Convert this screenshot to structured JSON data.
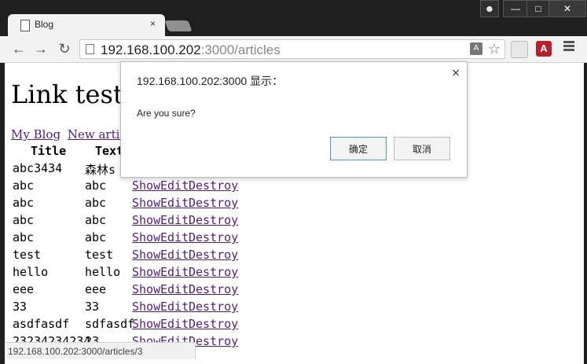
{
  "browser": {
    "tab_title": "Blog",
    "tab_close": "×",
    "window_buttons": [
      "—",
      "□",
      "✕"
    ],
    "url_host": "192.168.100.202",
    "url_path": ":3000/articles",
    "translate_icon": "A"
  },
  "page": {
    "title": "Link test",
    "links": [
      {
        "label": "My Blog"
      },
      {
        "label": "New article"
      }
    ],
    "table": {
      "headers": [
        "Title",
        "Text"
      ],
      "rows": [
        {
          "title": "abc3434",
          "text": "森林s",
          "show": "",
          "edit": "",
          "destroy": ""
        },
        {
          "title": "abc",
          "text": "abc",
          "show": "Show",
          "edit": "Edit",
          "destroy": "Destroy"
        },
        {
          "title": "abc",
          "text": "abc",
          "show": "Show",
          "edit": "Edit",
          "destroy": "Destroy"
        },
        {
          "title": "abc",
          "text": "abc",
          "show": "Show",
          "edit": "Edit",
          "destroy": "Destroy"
        },
        {
          "title": "abc",
          "text": "abc",
          "show": "Show",
          "edit": "Edit",
          "destroy": "Destroy"
        },
        {
          "title": "test",
          "text": "test",
          "show": "Show",
          "edit": "Edit",
          "destroy": "Destroy"
        },
        {
          "title": "hello",
          "text": "hello",
          "show": "Show",
          "edit": "Edit",
          "destroy": "Destroy"
        },
        {
          "title": "eee",
          "text": "eee",
          "show": "Show",
          "edit": "Edit",
          "destroy": "Destroy"
        },
        {
          "title": "33",
          "text": "33",
          "show": "Show",
          "edit": "Edit",
          "destroy": "Destroy"
        },
        {
          "title": "asdfasdf",
          "text": "sdfasdf",
          "show": "Show",
          "edit": "Edit",
          "destroy": "Destroy"
        },
        {
          "title": "23234234234",
          "text": "23",
          "show": "Show",
          "edit": "Edit",
          "destroy": "Destroy"
        }
      ]
    }
  },
  "dialog": {
    "title": "192.168.100.202:3000 显示：",
    "message": "Are you sure?",
    "ok_label": "确定",
    "cancel_label": "取消",
    "close": "×"
  },
  "status_bar": {
    "url": "192.168.100.202:3000/articles/3"
  },
  "colors": {
    "link": "#551a8b",
    "chrome_dark": "#1f1f1f",
    "toolbar": "#f2f2f2"
  }
}
